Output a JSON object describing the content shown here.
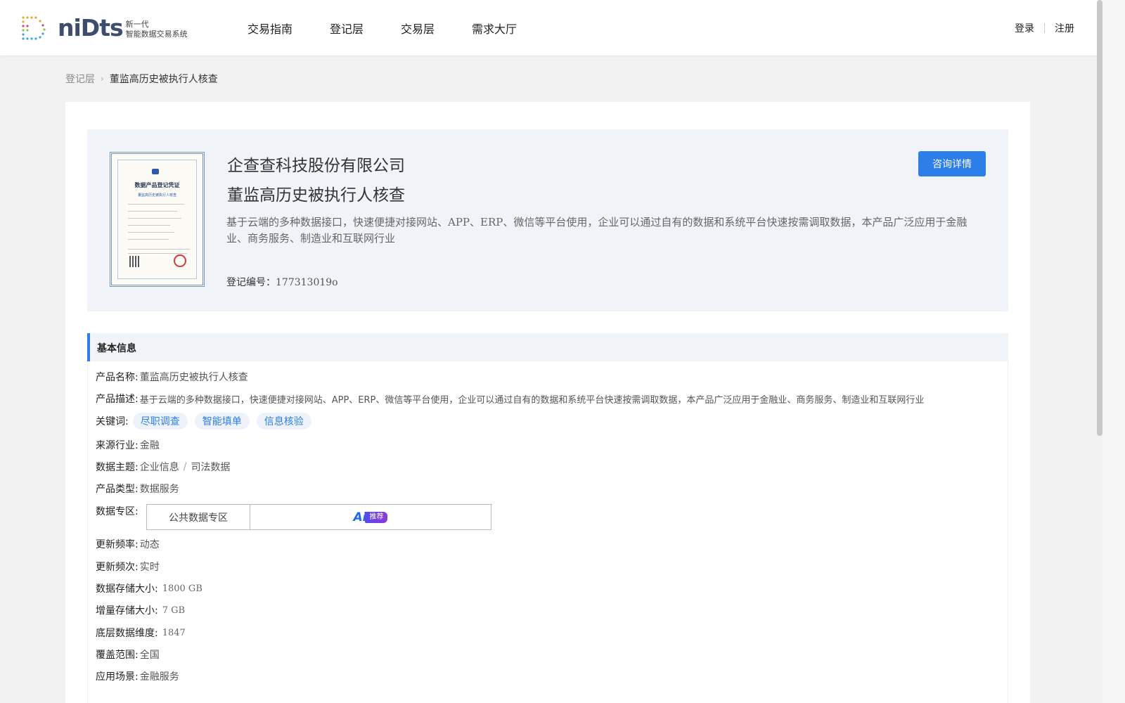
{
  "header": {
    "logo_word": "niDts",
    "logo_sub_1": "新一代",
    "logo_sub_2": "智能数据交易系统",
    "nav": [
      "交易指南",
      "登记层",
      "交易层",
      "需求大厅"
    ],
    "login": "登录",
    "register": "注册"
  },
  "breadcrumb": {
    "parent": "登记层",
    "current": "董监高历史被执行人核查"
  },
  "certificate": {
    "title": "数据产品登记凭证",
    "subtitle": "董监高历史被执行人核查"
  },
  "summary": {
    "company": "企查查科技股份有限公司",
    "product": "董监高历史被执行人核查",
    "description": "基于云端的多种数据接口，快速便捷对接网站、APP、ERP、微信等平台使用，企业可以通过自有的数据和系统平台快速按需调取数据，本产品广泛应用于金融业、商务服务、制造业和互联网行业",
    "reg_label": "登记编号：",
    "reg_no": "177313019o",
    "consult_button": "咨询详情"
  },
  "basic_info": {
    "title": "基本信息",
    "product_name_label": "产品名称:",
    "product_name": "董监高历史被执行人核查",
    "product_desc_label": "产品描述:",
    "product_desc": "基于云端的多种数据接口，快速便捷对接网站、APP、ERP、微信等平台使用，企业可以通过自有的数据和系统平台快速按需调取数据，本产品广泛应用于金融业、商务服务、制造业和互联网行业",
    "keywords_label": "关键词:",
    "keywords": [
      "尽职调查",
      "智能填单",
      "信息核验"
    ],
    "industry_label": "来源行业:",
    "industry": "金融",
    "theme_label": "数据主题:",
    "theme_1": "企业信息",
    "theme_sep": "/",
    "theme_2": "司法数据",
    "type_label": "产品类型:",
    "type": "数据服务",
    "zone_label": "数据专区:",
    "zone_public": "公共数据专区",
    "ai_logo": "Ai",
    "ai_tag": "推荐",
    "freq_label": "更新频率:",
    "freq": "动态",
    "times_label": "更新频次:",
    "times": "实时",
    "storage_label": "数据存储大小:",
    "storage": "1800 GB",
    "incr_label": "增量存储大小:",
    "incr": "7 GB",
    "dim_label": "底层数据维度:",
    "dim": "1847",
    "coverage_label": "覆盖范围:",
    "coverage": "全国",
    "scene_label": "应用场景:",
    "scene": "金融服务"
  },
  "colors": {
    "accent": "#2d7ee8",
    "panel": "#f0f4f8",
    "page_bg": "#f2f2f2"
  }
}
